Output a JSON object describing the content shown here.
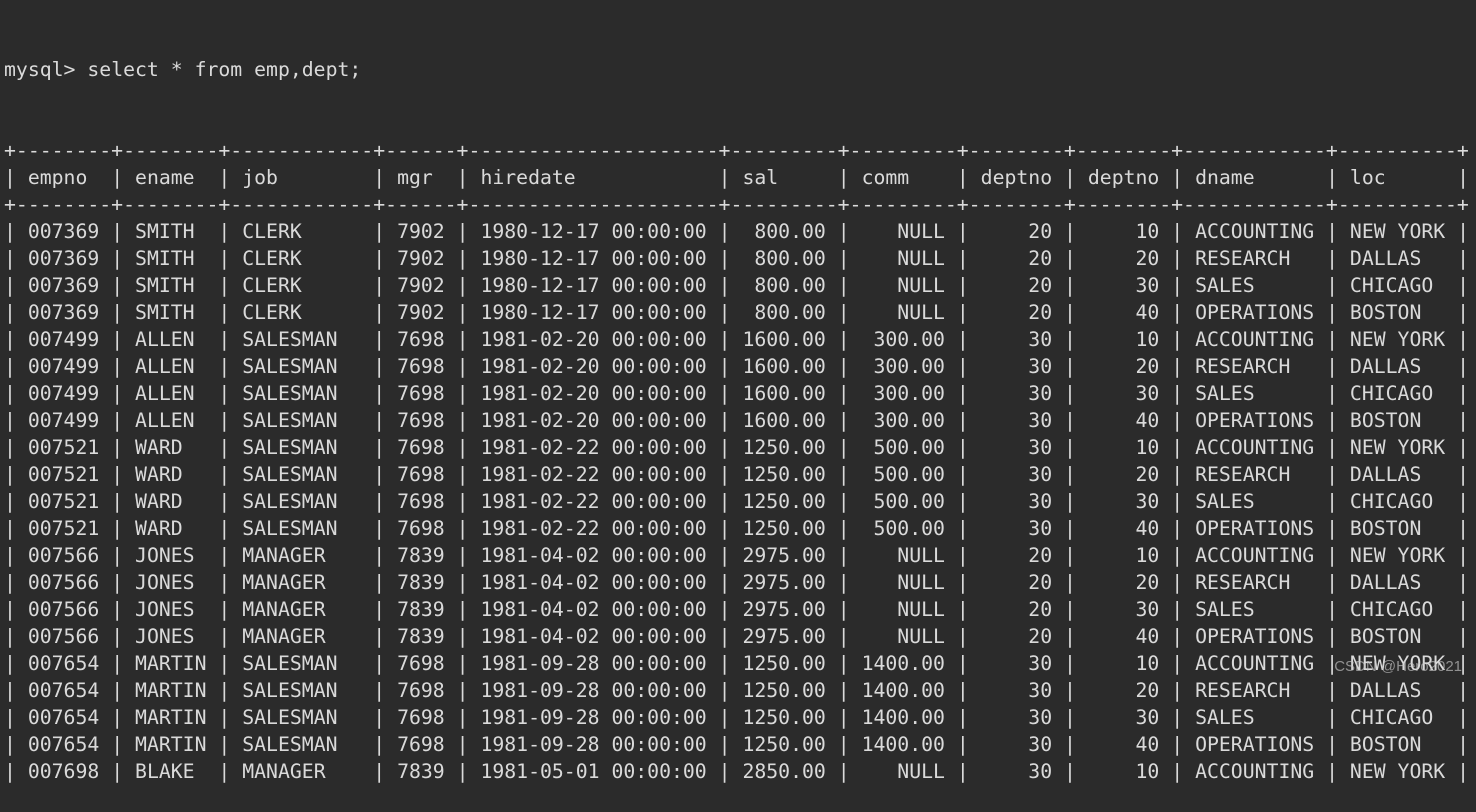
{
  "terminal": {
    "prompt": "mysql>",
    "command": "select * from emp,dept;"
  },
  "table": {
    "columns": [
      {
        "name": "empno",
        "width": 6,
        "align": "left"
      },
      {
        "name": "ename",
        "width": 6,
        "align": "left"
      },
      {
        "name": "job",
        "width": 10,
        "align": "left"
      },
      {
        "name": "mgr",
        "width": 4,
        "align": "left"
      },
      {
        "name": "hiredate",
        "width": 19,
        "align": "left"
      },
      {
        "name": "sal",
        "width": 7,
        "align": "right"
      },
      {
        "name": "comm",
        "width": 7,
        "align": "right"
      },
      {
        "name": "deptno",
        "width": 6,
        "align": "right"
      },
      {
        "name": "deptno",
        "width": 6,
        "align": "right"
      },
      {
        "name": "dname",
        "width": 10,
        "align": "left"
      },
      {
        "name": "loc",
        "width": 8,
        "align": "left"
      }
    ],
    "rows": [
      [
        "007369",
        "SMITH",
        "CLERK",
        "7902",
        "1980-12-17 00:00:00",
        "800.00",
        "NULL",
        "20",
        "10",
        "ACCOUNTING",
        "NEW YORK"
      ],
      [
        "007369",
        "SMITH",
        "CLERK",
        "7902",
        "1980-12-17 00:00:00",
        "800.00",
        "NULL",
        "20",
        "20",
        "RESEARCH",
        "DALLAS"
      ],
      [
        "007369",
        "SMITH",
        "CLERK",
        "7902",
        "1980-12-17 00:00:00",
        "800.00",
        "NULL",
        "20",
        "30",
        "SALES",
        "CHICAGO"
      ],
      [
        "007369",
        "SMITH",
        "CLERK",
        "7902",
        "1980-12-17 00:00:00",
        "800.00",
        "NULL",
        "20",
        "40",
        "OPERATIONS",
        "BOSTON"
      ],
      [
        "007499",
        "ALLEN",
        "SALESMAN",
        "7698",
        "1981-02-20 00:00:00",
        "1600.00",
        "300.00",
        "30",
        "10",
        "ACCOUNTING",
        "NEW YORK"
      ],
      [
        "007499",
        "ALLEN",
        "SALESMAN",
        "7698",
        "1981-02-20 00:00:00",
        "1600.00",
        "300.00",
        "30",
        "20",
        "RESEARCH",
        "DALLAS"
      ],
      [
        "007499",
        "ALLEN",
        "SALESMAN",
        "7698",
        "1981-02-20 00:00:00",
        "1600.00",
        "300.00",
        "30",
        "30",
        "SALES",
        "CHICAGO"
      ],
      [
        "007499",
        "ALLEN",
        "SALESMAN",
        "7698",
        "1981-02-20 00:00:00",
        "1600.00",
        "300.00",
        "30",
        "40",
        "OPERATIONS",
        "BOSTON"
      ],
      [
        "007521",
        "WARD",
        "SALESMAN",
        "7698",
        "1981-02-22 00:00:00",
        "1250.00",
        "500.00",
        "30",
        "10",
        "ACCOUNTING",
        "NEW YORK"
      ],
      [
        "007521",
        "WARD",
        "SALESMAN",
        "7698",
        "1981-02-22 00:00:00",
        "1250.00",
        "500.00",
        "30",
        "20",
        "RESEARCH",
        "DALLAS"
      ],
      [
        "007521",
        "WARD",
        "SALESMAN",
        "7698",
        "1981-02-22 00:00:00",
        "1250.00",
        "500.00",
        "30",
        "30",
        "SALES",
        "CHICAGO"
      ],
      [
        "007521",
        "WARD",
        "SALESMAN",
        "7698",
        "1981-02-22 00:00:00",
        "1250.00",
        "500.00",
        "30",
        "40",
        "OPERATIONS",
        "BOSTON"
      ],
      [
        "007566",
        "JONES",
        "MANAGER",
        "7839",
        "1981-04-02 00:00:00",
        "2975.00",
        "NULL",
        "20",
        "10",
        "ACCOUNTING",
        "NEW YORK"
      ],
      [
        "007566",
        "JONES",
        "MANAGER",
        "7839",
        "1981-04-02 00:00:00",
        "2975.00",
        "NULL",
        "20",
        "20",
        "RESEARCH",
        "DALLAS"
      ],
      [
        "007566",
        "JONES",
        "MANAGER",
        "7839",
        "1981-04-02 00:00:00",
        "2975.00",
        "NULL",
        "20",
        "30",
        "SALES",
        "CHICAGO"
      ],
      [
        "007566",
        "JONES",
        "MANAGER",
        "7839",
        "1981-04-02 00:00:00",
        "2975.00",
        "NULL",
        "20",
        "40",
        "OPERATIONS",
        "BOSTON"
      ],
      [
        "007654",
        "MARTIN",
        "SALESMAN",
        "7698",
        "1981-09-28 00:00:00",
        "1250.00",
        "1400.00",
        "30",
        "10",
        "ACCOUNTING",
        "NEW YORK"
      ],
      [
        "007654",
        "MARTIN",
        "SALESMAN",
        "7698",
        "1981-09-28 00:00:00",
        "1250.00",
        "1400.00",
        "30",
        "20",
        "RESEARCH",
        "DALLAS"
      ],
      [
        "007654",
        "MARTIN",
        "SALESMAN",
        "7698",
        "1981-09-28 00:00:00",
        "1250.00",
        "1400.00",
        "30",
        "30",
        "SALES",
        "CHICAGO"
      ],
      [
        "007654",
        "MARTIN",
        "SALESMAN",
        "7698",
        "1981-09-28 00:00:00",
        "1250.00",
        "1400.00",
        "30",
        "40",
        "OPERATIONS",
        "BOSTON"
      ],
      [
        "007698",
        "BLAKE",
        "MANAGER",
        "7839",
        "1981-05-01 00:00:00",
        "2850.00",
        "NULL",
        "30",
        "10",
        "ACCOUNTING",
        "NEW YORK"
      ]
    ]
  },
  "watermark": "CSDN @Hero2021",
  "colors": {
    "background": "#2b2b2b",
    "text": "#dadada"
  }
}
